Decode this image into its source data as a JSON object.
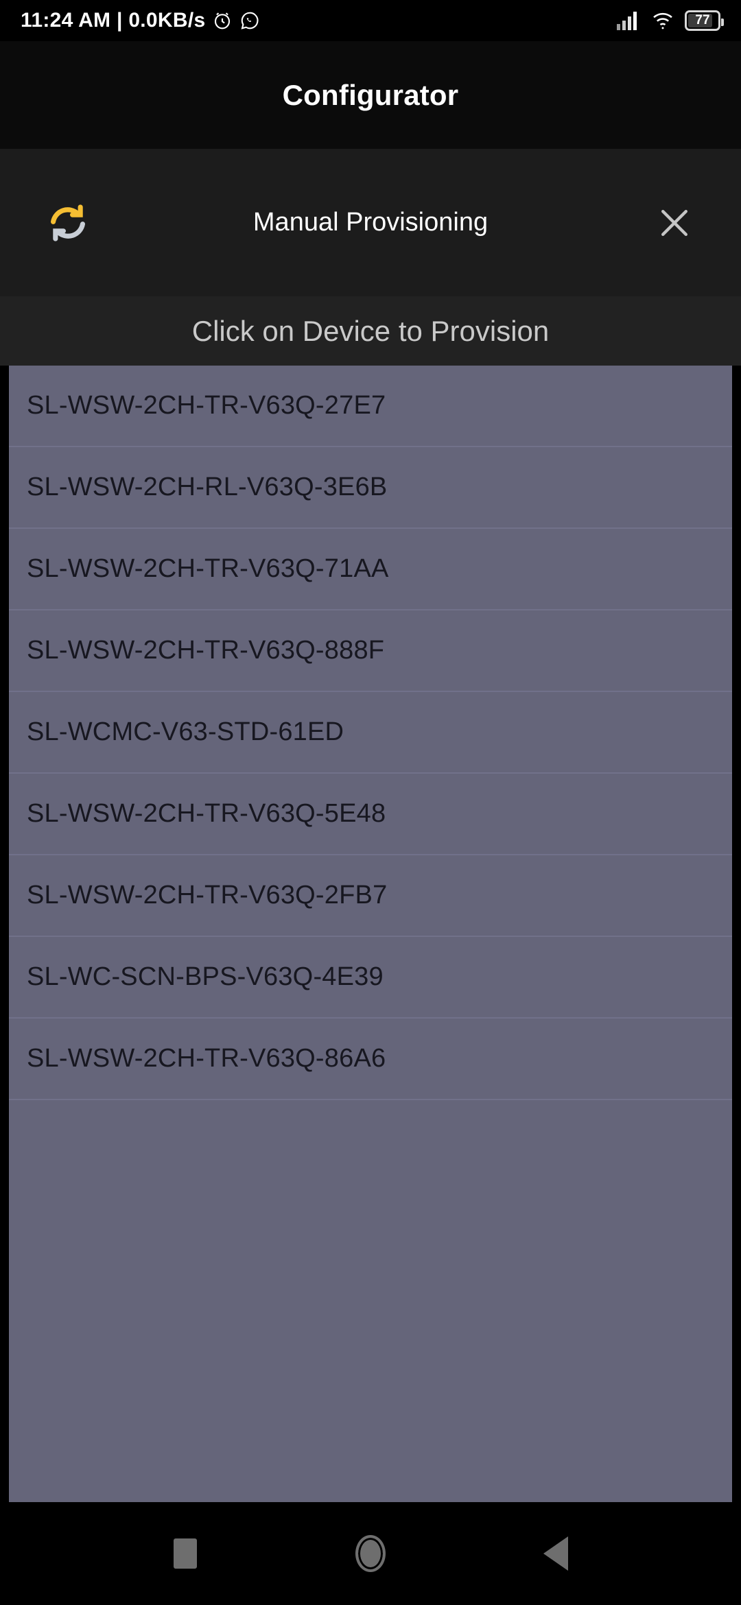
{
  "status_bar": {
    "clock_and_rate": "11:24 AM | 0.0KB/s",
    "alarm_icon": "alarm-clock-icon",
    "whatsapp_icon": "whatsapp-icon",
    "signal_icon": "cellular-signal-icon",
    "wifi_icon": "wifi-icon",
    "battery_level": "77",
    "battery_icon": "battery-icon"
  },
  "header": {
    "title": "Configurator"
  },
  "subheader": {
    "refresh_icon": "refresh-sync-icon",
    "title": "Manual Provisioning",
    "close_icon": "close-x-icon"
  },
  "instruction": {
    "text": "Click on Device to Provision"
  },
  "device_list": {
    "items": [
      {
        "label": "SL-WSW-2CH-TR-V63Q-27E7"
      },
      {
        "label": "SL-WSW-2CH-RL-V63Q-3E6B"
      },
      {
        "label": "SL-WSW-2CH-TR-V63Q-71AA"
      },
      {
        "label": "SL-WSW-2CH-TR-V63Q-888F"
      },
      {
        "label": "SL-WCMC-V63-STD-61ED"
      },
      {
        "label": "SL-WSW-2CH-TR-V63Q-5E48"
      },
      {
        "label": "SL-WSW-2CH-TR-V63Q-2FB7"
      },
      {
        "label": "SL-WC-SCN-BPS-V63Q-4E39"
      },
      {
        "label": "SL-WSW-2CH-TR-V63Q-86A6"
      },
      {
        "label": ""
      }
    ]
  },
  "nav_bar": {
    "recents_icon": "square-recents-icon",
    "home_icon": "circle-home-icon",
    "back_icon": "triangle-back-icon"
  },
  "colors": {
    "accent_amber": "#f5be33",
    "accent_silver": "#c8ced6",
    "list_background": "#65657a",
    "list_divider": "#71718a",
    "list_text": "#171720",
    "panel_background": "#1c1c1c",
    "instruction_text": "#c9c9c9",
    "nav_icon": "#6e6e6e"
  }
}
